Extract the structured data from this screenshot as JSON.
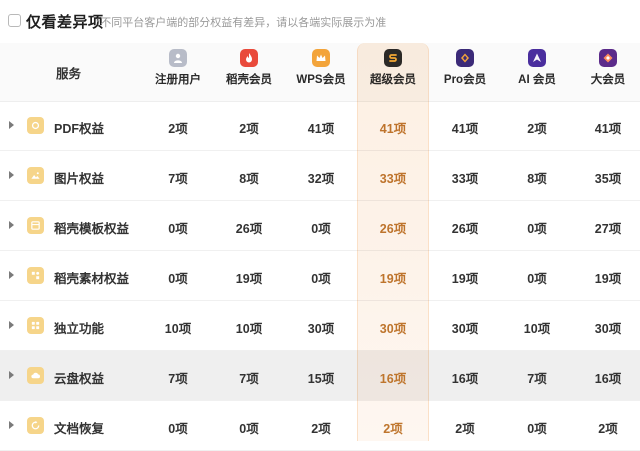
{
  "filter": {
    "label": "仅看差异项",
    "hint": "*不同平台客户端的部分权益有差异，请以各端实际展示为准"
  },
  "table": {
    "service_header": "服务",
    "columns": [
      {
        "name": "注册用户",
        "icon": "user-icon",
        "color": "#b8bcc8"
      },
      {
        "name": "稻壳会员",
        "icon": "docer-flame-icon",
        "color": "#e94a3b"
      },
      {
        "name": "WPS会员",
        "icon": "crown-icon",
        "color": "#f3a43a"
      },
      {
        "name": "超级会员",
        "icon": "super-s-icon",
        "color": "#2b2b2b"
      },
      {
        "name": "Pro会员",
        "icon": "pro-icon",
        "color": "#3b2a78"
      },
      {
        "name": "AI 会员",
        "icon": "ai-icon",
        "color": "#4a2e9e"
      },
      {
        "name": "大会员",
        "icon": "big-member-icon",
        "color": "#5b2a8a"
      }
    ],
    "rows": [
      {
        "label": "PDF权益",
        "icon": "pdf-folder-icon",
        "values": [
          "2项",
          "2项",
          "41项",
          "41项",
          "41项",
          "2项",
          "41项"
        ]
      },
      {
        "label": "图片权益",
        "icon": "image-folder-icon",
        "values": [
          "7项",
          "8项",
          "32项",
          "33项",
          "33项",
          "8项",
          "35项"
        ]
      },
      {
        "label": "稻壳模板权益",
        "icon": "template-folder-icon",
        "values": [
          "0项",
          "26项",
          "0项",
          "26项",
          "26项",
          "0项",
          "27项"
        ]
      },
      {
        "label": "稻壳素材权益",
        "icon": "material-folder-icon",
        "values": [
          "0项",
          "19项",
          "0项",
          "19项",
          "19项",
          "0项",
          "19项"
        ]
      },
      {
        "label": "独立功能",
        "icon": "grid-folder-icon",
        "values": [
          "10项",
          "10项",
          "30项",
          "30项",
          "30项",
          "10项",
          "30项"
        ]
      },
      {
        "label": "云盘权益",
        "icon": "cloud-folder-icon",
        "values": [
          "7项",
          "7项",
          "15项",
          "16项",
          "16项",
          "7项",
          "16项"
        ]
      },
      {
        "label": "文档恢复",
        "icon": "restore-folder-icon",
        "values": [
          "0项",
          "0项",
          "2项",
          "2项",
          "2项",
          "0项",
          "2项"
        ]
      }
    ],
    "highlight_column": 3,
    "shaded_row": 5
  }
}
